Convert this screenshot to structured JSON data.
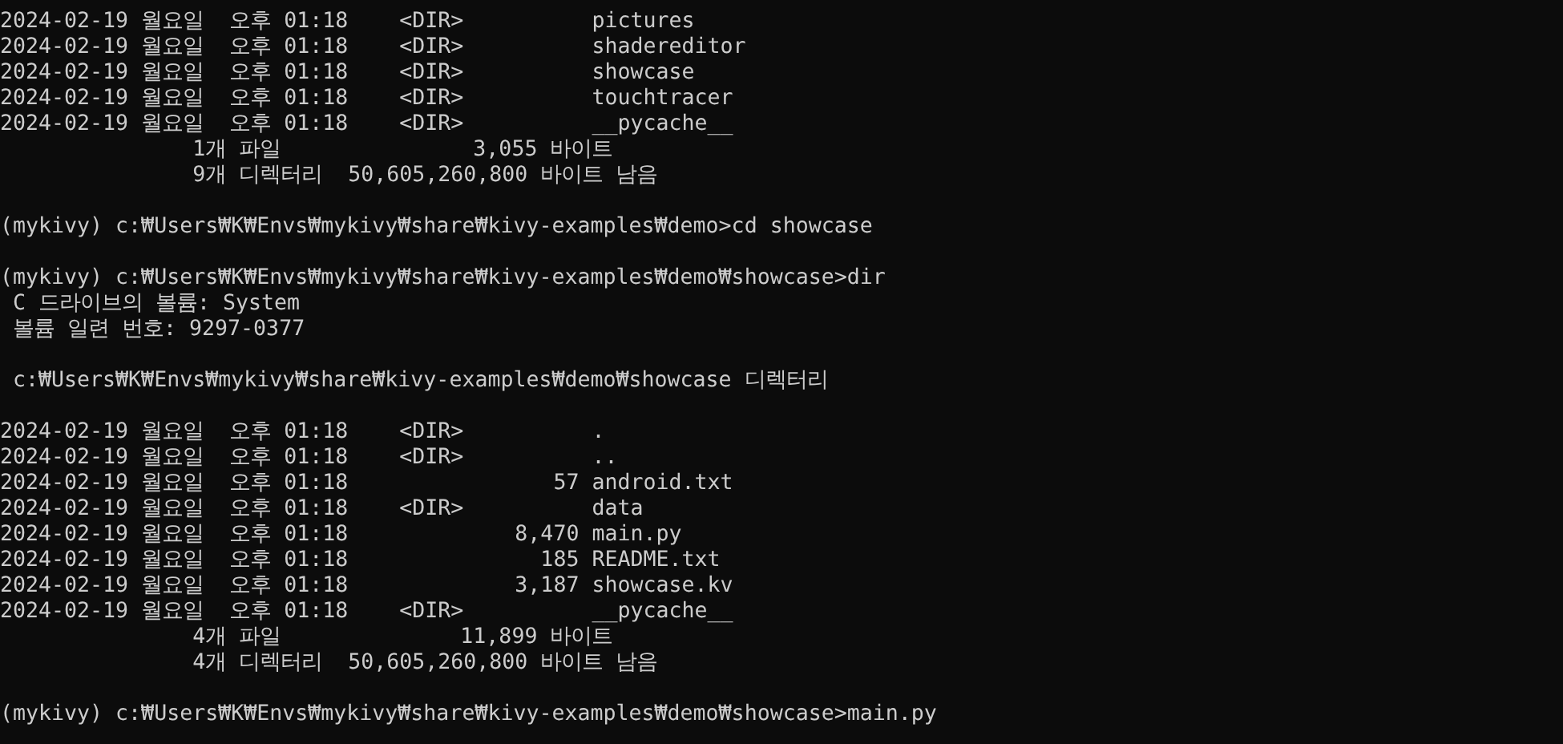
{
  "console": {
    "blocks": [
      [
        "2024-02-19 월요일  오후 01:18    <DIR>          pictures",
        "2024-02-19 월요일  오후 01:18    <DIR>          shadereditor",
        "2024-02-19 월요일  오후 01:18    <DIR>          showcase",
        "2024-02-19 월요일  오후 01:18    <DIR>          touchtracer",
        "2024-02-19 월요일  오후 01:18    <DIR>          __pycache__",
        "               1개 파일               3,055 바이트",
        "               9개 디렉터리  50,605,260,800 바이트 남음"
      ],
      [
        "(mykivy) c:₩Users₩K₩Envs₩mykivy₩share₩kivy-examples₩demo>cd showcase"
      ],
      [
        "(mykivy) c:₩Users₩K₩Envs₩mykivy₩share₩kivy-examples₩demo₩showcase>dir",
        " C 드라이브의 볼륨: System",
        " 볼륨 일련 번호: 9297-0377"
      ],
      [
        " c:₩Users₩K₩Envs₩mykivy₩share₩kivy-examples₩demo₩showcase 디렉터리"
      ],
      [
        "2024-02-19 월요일  오후 01:18    <DIR>          .",
        "2024-02-19 월요일  오후 01:18    <DIR>          ..",
        "2024-02-19 월요일  오후 01:18                57 android.txt",
        "2024-02-19 월요일  오후 01:18    <DIR>          data",
        "2024-02-19 월요일  오후 01:18             8,470 main.py",
        "2024-02-19 월요일  오후 01:18               185 README.txt",
        "2024-02-19 월요일  오후 01:18             3,187 showcase.kv",
        "2024-02-19 월요일  오후 01:18    <DIR>          __pycache__",
        "               4개 파일              11,899 바이트",
        "               4개 디렉터리  50,605,260,800 바이트 남음"
      ],
      [
        "(mykivy) c:₩Users₩K₩Envs₩mykivy₩share₩kivy-examples₩demo₩showcase>main.py"
      ]
    ]
  }
}
